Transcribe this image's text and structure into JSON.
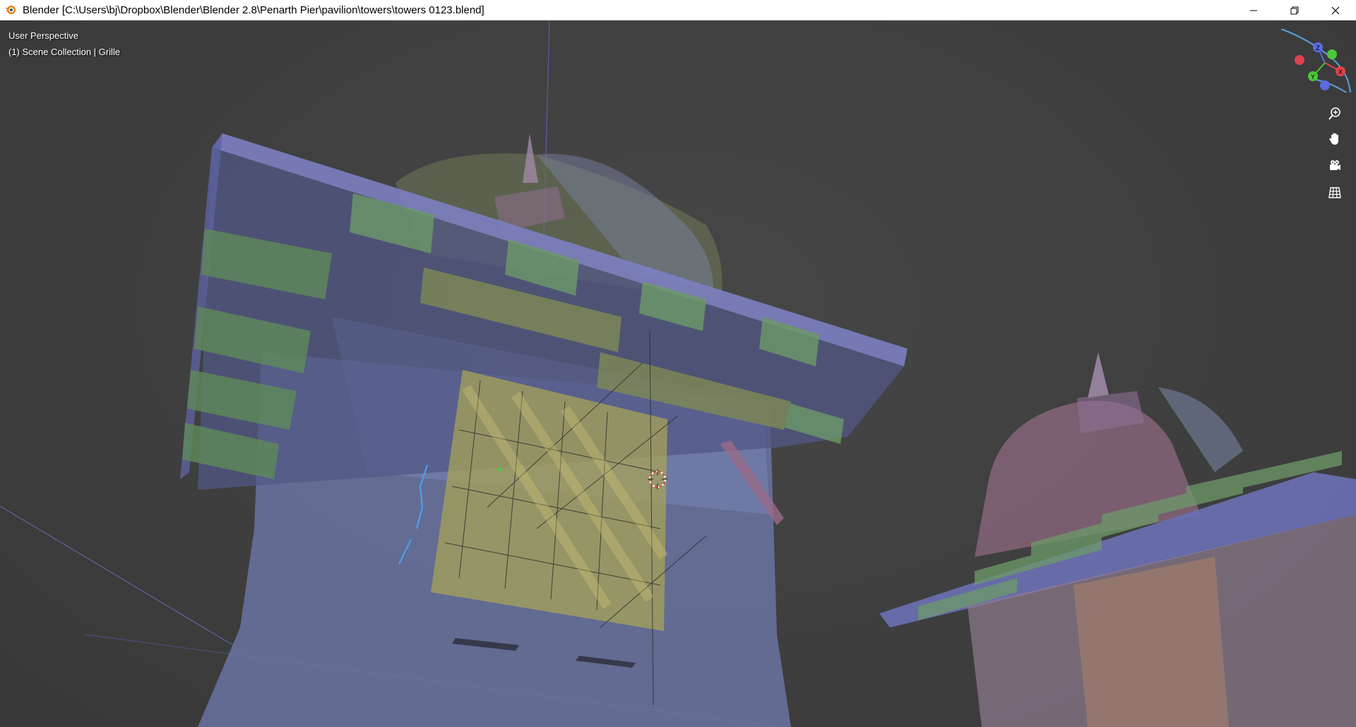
{
  "window": {
    "title": "Blender [C:\\Users\\bj\\Dropbox\\Blender\\Blender 2.8\\Penarth Pier\\pavilion\\towers\\towers 0123.blend]",
    "controls": {
      "minimize_icon": "minimize-icon",
      "restore_icon": "restore-icon",
      "close_icon": "close-icon"
    }
  },
  "viewport": {
    "view_name": "User Perspective",
    "collection_info": "(1) Scene Collection | Grille"
  },
  "navigation_gizmo": {
    "axes": [
      "X",
      "Y",
      "Z"
    ],
    "colors": {
      "x": "#e0424c",
      "y": "#4cc83a",
      "z": "#5a6ce0"
    }
  },
  "nav_tools": [
    "zoom-icon",
    "pan-hand-icon",
    "camera-view-icon",
    "ortho-grid-icon"
  ]
}
